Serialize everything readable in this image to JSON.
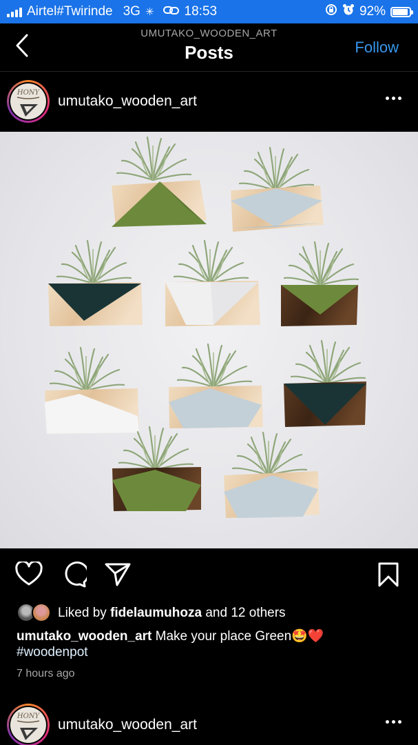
{
  "status_bar": {
    "carrier": "Airtel#Twirinde",
    "network": "3G",
    "time": "18:53",
    "battery": "92%",
    "battery_level": 0.92
  },
  "header": {
    "subtitle": "UMUTAKO_WOODEN_ART",
    "title": "Posts",
    "follow_label": "Follow"
  },
  "post": {
    "username": "umutako_wooden_art",
    "likes_prefix": "Liked by",
    "liked_by_user": "fidelaumuhoza",
    "likes_suffix": "and 12 others",
    "caption_username": "umutako_wooden_art",
    "caption_text": "Make your place Green🤩❤️",
    "hashtag": "#woodenpot",
    "time_ago": "7 hours ago"
  },
  "next_post": {
    "username": "umutako_wooden_art"
  },
  "colors": {
    "status_bar": "#1a73e8",
    "follow": "#3897f0",
    "background": "#000000"
  },
  "icons": [
    "back-icon",
    "more-icon",
    "heart-icon",
    "comment-icon",
    "share-icon",
    "bookmark-icon"
  ]
}
